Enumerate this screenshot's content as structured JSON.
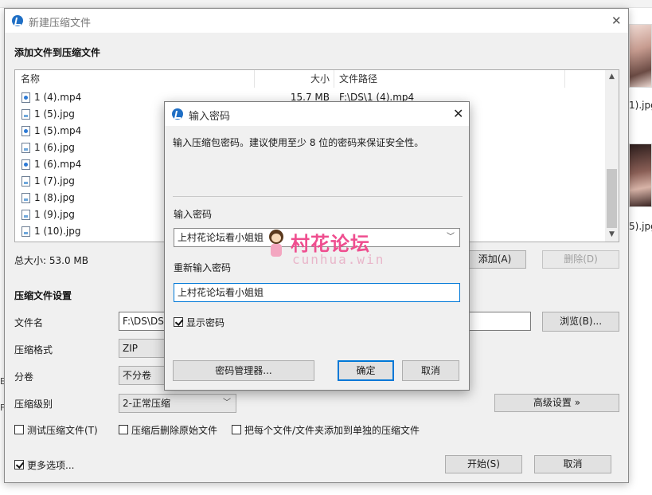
{
  "background": {
    "thumbnails": [
      {
        "label": "1).jpg"
      },
      {
        "label": "5).jpg"
      }
    ],
    "left_marks": [
      "E",
      "F"
    ]
  },
  "main_window": {
    "title": "新建压缩文件",
    "section_add": "添加文件到压缩文件",
    "columns": {
      "name": "名称",
      "size": "大小",
      "path": "文件路径"
    },
    "files": [
      {
        "name": "1 (4).mp4",
        "size": "15.7 MB",
        "path": "F:\\DS\\1 (4).mp4",
        "kind": "video"
      },
      {
        "name": "1 (5).jpg",
        "size": "",
        "path": "",
        "kind": "image"
      },
      {
        "name": "1 (5).mp4",
        "size": "",
        "path": "",
        "kind": "video"
      },
      {
        "name": "1 (6).jpg",
        "size": "",
        "path": "",
        "kind": "image"
      },
      {
        "name": "1 (6).mp4",
        "size": "",
        "path": "",
        "kind": "video"
      },
      {
        "name": "1 (7).jpg",
        "size": "",
        "path": "",
        "kind": "image"
      },
      {
        "name": "1 (8).jpg",
        "size": "",
        "path": "",
        "kind": "image"
      },
      {
        "name": "1 (9).jpg",
        "size": "",
        "path": "",
        "kind": "image"
      },
      {
        "name": "1 (10).jpg",
        "size": "",
        "path": "",
        "kind": "image"
      }
    ],
    "total_size": "总大小: 53.0 MB",
    "add_button": "添加(A)",
    "delete_button": "删除(D)",
    "section_settings": "压缩文件设置",
    "filename_label": "文件名",
    "filename_value": "F:\\DS\\DS.",
    "browse_button": "浏览(B)...",
    "format_label": "压缩格式",
    "format_value": "ZIP",
    "split_label": "分卷",
    "split_value": "不分卷",
    "level_label": "压缩级别",
    "level_value": "2-正常压缩",
    "advanced_button": "高级设置 »",
    "test_checkbox": "测试压缩文件(T)",
    "delete_after_checkbox": "压缩后删除原始文件",
    "separate_checkbox": "把每个文件/文件夹添加到单独的压缩文件",
    "more_options": "更多选项...",
    "start_button": "开始(S)",
    "cancel_button": "取消"
  },
  "password_dialog": {
    "title": "输入密码",
    "hint": "输入压缩包密码。建议使用至少 8 位的密码来保证安全性。",
    "password_label": "输入密码",
    "password_value": "上村花论坛看小姐姐",
    "reenter_label": "重新输入密码",
    "reenter_value": "上村花论坛看小姐姐",
    "show_password": "显示密码",
    "manager_button": "密码管理器...",
    "ok_button": "确定",
    "cancel_button": "取消"
  },
  "watermark": {
    "title": "村花论坛",
    "url": "cunhua.win"
  },
  "colors": {
    "accent": "#0078d7",
    "watermark": "#ef4e8f",
    "dialog_bg": "#f0f0f0"
  }
}
